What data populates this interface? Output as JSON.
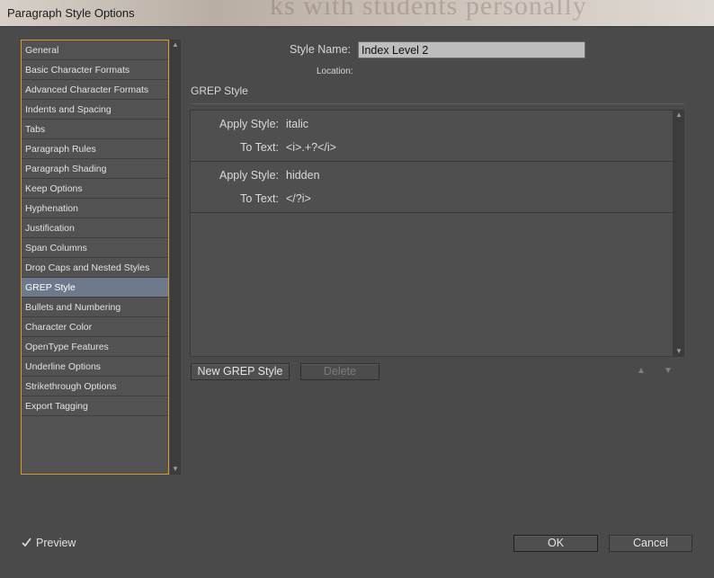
{
  "window": {
    "title": "Paragraph Style Options",
    "backdrop_text": "ks with students personally"
  },
  "sidebar": {
    "items": [
      {
        "label": "General"
      },
      {
        "label": "Basic Character Formats"
      },
      {
        "label": "Advanced Character Formats"
      },
      {
        "label": "Indents and Spacing"
      },
      {
        "label": "Tabs"
      },
      {
        "label": "Paragraph Rules"
      },
      {
        "label": "Paragraph Shading"
      },
      {
        "label": "Keep Options"
      },
      {
        "label": "Hyphenation"
      },
      {
        "label": "Justification"
      },
      {
        "label": "Span Columns"
      },
      {
        "label": "Drop Caps and Nested Styles"
      },
      {
        "label": "GREP Style",
        "selected": true
      },
      {
        "label": "Bullets and Numbering"
      },
      {
        "label": "Character Color"
      },
      {
        "label": "OpenType Features"
      },
      {
        "label": "Underline Options"
      },
      {
        "label": "Strikethrough Options"
      },
      {
        "label": "Export Tagging"
      }
    ]
  },
  "form": {
    "style_name_label": "Style Name:",
    "style_name_value": "Index Level 2",
    "location_label": "Location:"
  },
  "grep": {
    "section_title": "GREP Style",
    "entries": [
      {
        "apply_label": "Apply Style:",
        "apply_value": "italic",
        "text_label": "To Text:",
        "text_value": "<i>.+?</i>"
      },
      {
        "apply_label": "Apply Style:",
        "apply_value": "hidden",
        "text_label": "To Text:",
        "text_value": "</?i>"
      }
    ],
    "new_button": "New GREP Style",
    "delete_button": "Delete"
  },
  "footer": {
    "preview_label": "Preview",
    "preview_checked": true,
    "ok_label": "OK",
    "cancel_label": "Cancel"
  },
  "colors": {
    "accent_border": "#d79a2a",
    "selected_row": "#6e7a8c",
    "panel_bg": "#4a4a4a"
  }
}
